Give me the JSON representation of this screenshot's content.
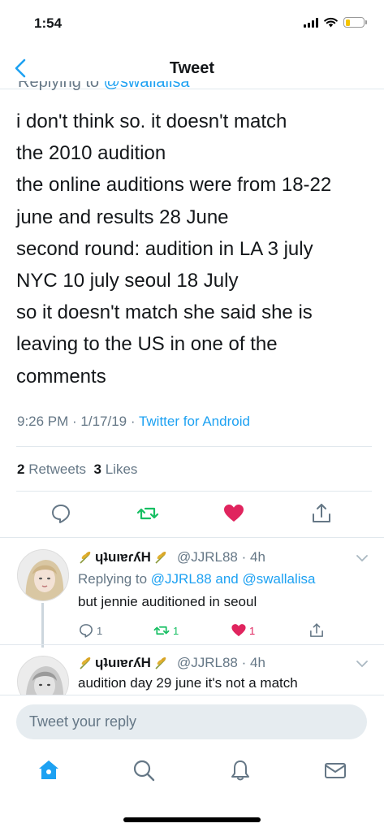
{
  "status": {
    "time": "1:54"
  },
  "nav": {
    "title": "Tweet",
    "back_icon": "chevron-left-icon"
  },
  "tweet": {
    "replying_prefix": "Replying to ",
    "replying_handle": "@swallalisa",
    "lines": [
      "i don't think so. it doesn't match",
      "the 2010 audition",
      "the online auditions were from 18-22",
      "june and results 28 June",
      "second round: audition in LA 3 july",
      "NYC 10 july seoul 18 July",
      "so it doesn't match she said she is",
      "leaving to the US in one of the",
      "comments"
    ],
    "timestamp": "9:26 PM · 1/17/19 · ",
    "source": "Twitter for Android",
    "retweets_count": "2",
    "retweets_label": " Retweets  ",
    "likes_count": "3",
    "likes_label": " Likes"
  },
  "replies": [
    {
      "name": "ɥʇuıɐɾʎH",
      "handle": "@JJRL88",
      "time": "4h",
      "replying_prefix": "Replying to ",
      "replying_handles": "@JJRL88 and @swallalisa",
      "text": "but jennie auditioned in seoul",
      "reply_count": "1",
      "retweet_count": "1",
      "like_count": "1"
    },
    {
      "name": "ɥʇuıɐɾʎH",
      "handle": "@JJRL88",
      "time": "4h",
      "text": "audition day 29 june it's not a match"
    }
  ],
  "composer": {
    "placeholder": "Tweet your reply"
  },
  "colors": {
    "accent": "#1da1f2",
    "retweet": "#17bf63",
    "like": "#e0245e",
    "muted": "#657786"
  },
  "tabs": [
    "home-icon",
    "search-icon",
    "notifications-bell-icon",
    "messages-envelope-icon"
  ]
}
